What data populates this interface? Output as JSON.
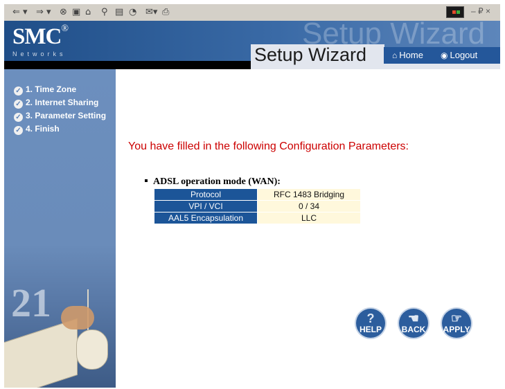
{
  "toolbar": {
    "back": "⇐ ▾",
    "forward": "⇒ ▾",
    "stop_icon": "stop-icon",
    "refresh_icon": "refresh-icon",
    "home_icon": "home-icon",
    "search_icon": "search-icon",
    "favorites_icon": "favorites-icon",
    "history_icon": "history-icon",
    "mail_icon": "mail-icon",
    "print_icon": "print-icon",
    "window_controls": "– ₽ ×"
  },
  "header": {
    "brand": "SMC",
    "brand_mark": "®",
    "brand_sub": "Networks",
    "watermark": "Setup Wizard",
    "title": "Setup Wizard",
    "nav": {
      "home": "Home",
      "logout": "Logout"
    },
    "accent": "#1f4e88"
  },
  "sidebar": {
    "steps": [
      {
        "label": "1. Time Zone"
      },
      {
        "label": "2. Internet Sharing"
      },
      {
        "label": "3. Parameter Setting"
      },
      {
        "label": "4. Finish"
      }
    ],
    "decoration_number": "21"
  },
  "main": {
    "summary": "You have filled in the following Configuration Parameters:",
    "section_title": "ADSL operation mode (WAN):",
    "rows": [
      {
        "label": "Protocol",
        "value": "RFC 1483 Bridging"
      },
      {
        "label": "VPI / VCI",
        "value": "0 / 34"
      },
      {
        "label": "AAL5 Encapsulation",
        "value": "LLC"
      }
    ],
    "buttons": {
      "help": "HELP",
      "back": "BACK",
      "apply": "APPLY"
    },
    "summary_color": "#cc0000"
  }
}
